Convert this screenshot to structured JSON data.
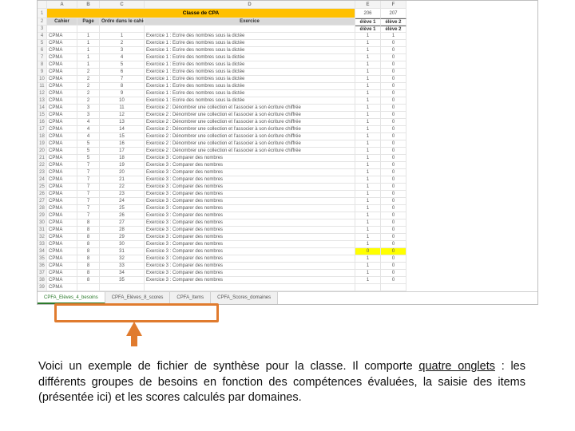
{
  "cols": [
    "A",
    "B",
    "C",
    "D",
    "E",
    "F"
  ],
  "title": "Classe de CPA",
  "headers": {
    "cahier": "Cahier",
    "page": "Page",
    "ordre": "Ordre dans le cahier",
    "exercice": "Exercice"
  },
  "eleves": [
    {
      "top": "élève 1",
      "bot": "élève 1",
      "key": "206"
    },
    {
      "top": "élève 2",
      "bot": "élève 2",
      "key": "207"
    }
  ],
  "rows": [
    {
      "n": 4,
      "c": "CPMA",
      "p": "1",
      "o": "1",
      "ex": "Exercice 1 : Ecrire des nombres sous la dictée",
      "v": [
        1,
        1
      ]
    },
    {
      "n": 5,
      "c": "CPMA",
      "p": "1",
      "o": "2",
      "ex": "Exercice 1 : Ecrire des nombres sous la dictée",
      "v": [
        1,
        0
      ]
    },
    {
      "n": 6,
      "c": "CPMA",
      "p": "1",
      "o": "3",
      "ex": "Exercice 1 : Ecrire des nombres sous la dictée",
      "v": [
        1,
        0
      ]
    },
    {
      "n": 7,
      "c": "CPMA",
      "p": "1",
      "o": "4",
      "ex": "Exercice 1 : Ecrire des nombres sous la dictée",
      "v": [
        1,
        0
      ]
    },
    {
      "n": 8,
      "c": "CPMA",
      "p": "1",
      "o": "5",
      "ex": "Exercice 1 : Ecrire des nombres sous la dictée",
      "v": [
        1,
        0
      ]
    },
    {
      "n": 9,
      "c": "CPMA",
      "p": "2",
      "o": "6",
      "ex": "Exercice 1 : Ecrire des nombres sous la dictée",
      "v": [
        1,
        0
      ]
    },
    {
      "n": 10,
      "c": "CPMA",
      "p": "2",
      "o": "7",
      "ex": "Exercice 1 : Ecrire des nombres sous la dictée",
      "v": [
        1,
        0
      ]
    },
    {
      "n": 11,
      "c": "CPMA",
      "p": "2",
      "o": "8",
      "ex": "Exercice 1 : Ecrire des nombres sous la dictée",
      "v": [
        1,
        0
      ]
    },
    {
      "n": 12,
      "c": "CPMA",
      "p": "2",
      "o": "9",
      "ex": "Exercice 1 : Ecrire des nombres sous la dictée",
      "v": [
        1,
        0
      ]
    },
    {
      "n": 13,
      "c": "CPMA",
      "p": "2",
      "o": "10",
      "ex": "Exercice 1 : Ecrire des nombres sous la dictée",
      "v": [
        1,
        0
      ]
    },
    {
      "n": 14,
      "c": "CPMA",
      "p": "3",
      "o": "11",
      "ex": "Exercice 2 : Dénombrer une collection et l'associer à son écriture chiffrée",
      "v": [
        1,
        0
      ]
    },
    {
      "n": 15,
      "c": "CPMA",
      "p": "3",
      "o": "12",
      "ex": "Exercice 2 : Dénombrer une collection et l'associer à son écriture chiffrée",
      "v": [
        1,
        0
      ]
    },
    {
      "n": 16,
      "c": "CPMA",
      "p": "4",
      "o": "13",
      "ex": "Exercice 2 : Dénombrer une collection et l'associer à son écriture chiffrée",
      "v": [
        1,
        0
      ]
    },
    {
      "n": 17,
      "c": "CPMA",
      "p": "4",
      "o": "14",
      "ex": "Exercice 2 : Dénombrer une collection et l'associer à son écriture chiffrée",
      "v": [
        1,
        0
      ]
    },
    {
      "n": 18,
      "c": "CPMA",
      "p": "4",
      "o": "15",
      "ex": "Exercice 2 : Dénombrer une collection et l'associer à son écriture chiffrée",
      "v": [
        1,
        0
      ]
    },
    {
      "n": 19,
      "c": "CPMA",
      "p": "5",
      "o": "16",
      "ex": "Exercice 2 : Dénombrer une collection et l'associer à son écriture chiffrée",
      "v": [
        1,
        0
      ]
    },
    {
      "n": 20,
      "c": "CPMA",
      "p": "5",
      "o": "17",
      "ex": "Exercice 2 : Dénombrer une collection et l'associer à son écriture chiffrée",
      "v": [
        1,
        0
      ]
    },
    {
      "n": 21,
      "c": "CPMA",
      "p": "5",
      "o": "18",
      "ex": "Exercice 3 : Comparer des nombres",
      "v": [
        1,
        0
      ]
    },
    {
      "n": 22,
      "c": "CPMA",
      "p": "7",
      "o": "19",
      "ex": "Exercice 3 : Comparer des nombres",
      "v": [
        1,
        0
      ]
    },
    {
      "n": 23,
      "c": "CPMA",
      "p": "7",
      "o": "20",
      "ex": "Exercice 3 : Comparer des nombres",
      "v": [
        1,
        0
      ]
    },
    {
      "n": 24,
      "c": "CPMA",
      "p": "7",
      "o": "21",
      "ex": "Exercice 3 : Comparer des nombres",
      "v": [
        1,
        0
      ]
    },
    {
      "n": 25,
      "c": "CPMA",
      "p": "7",
      "o": "22",
      "ex": "Exercice 3 : Comparer des nombres",
      "v": [
        1,
        0
      ]
    },
    {
      "n": 26,
      "c": "CPMA",
      "p": "7",
      "o": "23",
      "ex": "Exercice 3 : Comparer des nombres",
      "v": [
        1,
        0
      ]
    },
    {
      "n": 27,
      "c": "CPMA",
      "p": "7",
      "o": "24",
      "ex": "Exercice 3 : Comparer des nombres",
      "v": [
        1,
        0
      ]
    },
    {
      "n": 28,
      "c": "CPMA",
      "p": "7",
      "o": "25",
      "ex": "Exercice 3 : Comparer des nombres",
      "v": [
        1,
        0
      ]
    },
    {
      "n": 29,
      "c": "CPMA",
      "p": "7",
      "o": "26",
      "ex": "Exercice 3 : Comparer des nombres",
      "v": [
        1,
        0
      ]
    },
    {
      "n": 30,
      "c": "CPMA",
      "p": "8",
      "o": "27",
      "ex": "Exercice 3 : Comparer des nombres",
      "v": [
        1,
        0
      ]
    },
    {
      "n": 31,
      "c": "CPMA",
      "p": "8",
      "o": "28",
      "ex": "Exercice 3 : Comparer des nombres",
      "v": [
        1,
        0
      ]
    },
    {
      "n": 32,
      "c": "CPMA",
      "p": "8",
      "o": "29",
      "ex": "Exercice 3 : Comparer des nombres",
      "v": [
        1,
        0
      ]
    },
    {
      "n": 33,
      "c": "CPMA",
      "p": "8",
      "o": "30",
      "ex": "Exercice 3 : Comparer des nombres",
      "v": [
        1,
        0
      ]
    },
    {
      "n": 34,
      "c": "CPMA",
      "p": "8",
      "o": "31",
      "ex": "Exercice 3 : Comparer des nombres",
      "v": [
        0,
        0
      ],
      "hl": true
    },
    {
      "n": 35,
      "c": "CPMA",
      "p": "8",
      "o": "32",
      "ex": "Exercice 3 : Comparer des nombres",
      "v": [
        1,
        0
      ]
    },
    {
      "n": 36,
      "c": "CPMA",
      "p": "8",
      "o": "33",
      "ex": "Exercice 3 : Comparer des nombres",
      "v": [
        1,
        0
      ]
    },
    {
      "n": 37,
      "c": "CPMA",
      "p": "8",
      "o": "34",
      "ex": "Exercice 3 : Comparer des nombres",
      "v": [
        1,
        0
      ]
    },
    {
      "n": 38,
      "c": "CPMA",
      "p": "8",
      "o": "35",
      "ex": "Exercice 3 : Comparer des nombres",
      "v": [
        1,
        0
      ]
    },
    {
      "n": 39,
      "c": "CPMA",
      "p": "",
      "o": "",
      "ex": "",
      "v": [
        "",
        ""
      ]
    }
  ],
  "tabs": [
    {
      "label": "CPFA_Elèves_4_besoins",
      "active": true
    },
    {
      "label": "CPFA_Elèves_8_scores",
      "active": false
    },
    {
      "label": "CPFA_Items",
      "active": false
    },
    {
      "label": "CPFA_Scores_domaines",
      "active": false
    }
  ],
  "caption": {
    "t1": "Voici un exemple de fichier de synthèse pour la classe. Il comporte ",
    "u": "quatre onglets",
    "t2": " : les différents groupes de besoins en fonction des compétences évaluées, la saisie des items (présentée ici) et les scores calculés par domaines."
  }
}
